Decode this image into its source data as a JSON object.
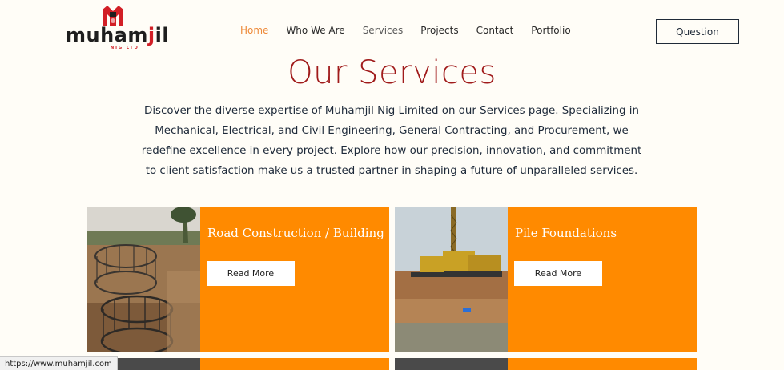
{
  "brand": {
    "name_prefix": "muham",
    "name_hl": "j",
    "name_suffix": "il",
    "tagline": "NIG LTD",
    "logo_color": "#d21f26"
  },
  "nav": {
    "items": [
      {
        "label": "Home"
      },
      {
        "label": "Who We Are"
      },
      {
        "label": "Services"
      },
      {
        "label": "Projects"
      },
      {
        "label": "Contact"
      },
      {
        "label": "Portfolio"
      }
    ],
    "active_item": "Home",
    "active_color": "#ee8a3a"
  },
  "header": {
    "question_button": "Question"
  },
  "page": {
    "title": "Our Services",
    "title_color": "#a01b1b",
    "intro": "Discover the diverse expertise of Muhamjil Nig Limited on our Services page. Specializing in Mechanical, Electrical, and Civil Engineering, General Contracting, and Procurement, we redefine excellence in every project. Explore how our precision, innovation, and commitment to client satisfaction make us a trusted partner in shaping a future of unparalleled services."
  },
  "services": [
    {
      "title": "Road Construction / Building",
      "button": "Read More",
      "photo": "rebar-cages-photo"
    },
    {
      "title": "Pile Foundations",
      "button": "Read More",
      "photo": "piling-rig-photo"
    }
  ],
  "card_color": "#ff8a00",
  "status_bar": {
    "url": "https://www.muhamjil.com"
  }
}
